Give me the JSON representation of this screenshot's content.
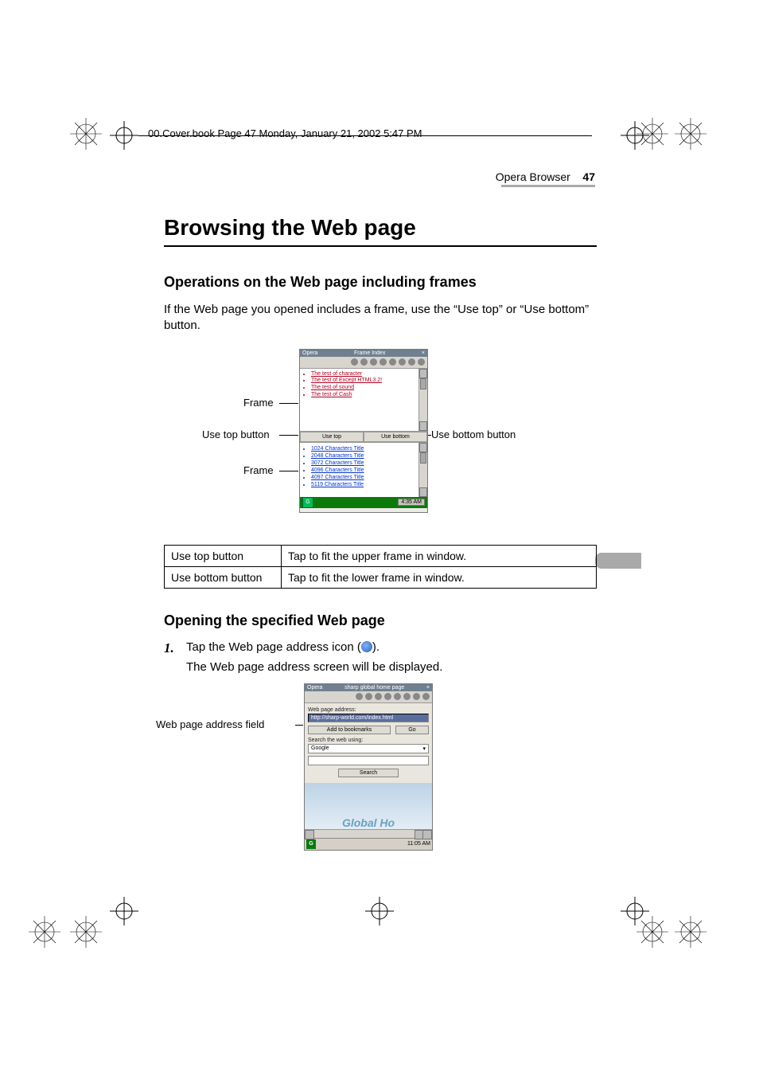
{
  "header_text": "00.Cover.book  Page 47  Monday, January 21, 2002  5:47 PM",
  "running_head": {
    "section": "Opera Browser",
    "page": "47"
  },
  "title": "Browsing the Web page",
  "sub1": "Operations on the Web page including frames",
  "para1": "If the Web page you opened includes a frame, use the “Use top” or “Use bottom” button.",
  "fig1": {
    "frame_label": "Frame",
    "use_top_label": "Use top button",
    "use_bottom_label": "Use bottom button",
    "shot": {
      "titlebar_left": "Opera",
      "titlebar_right": "Frame Index",
      "frame_links": [
        "The test of character",
        "The test of Except HTML3.2!",
        "The test of sound",
        "The test of Cash"
      ],
      "use_top": "Use top",
      "use_bottom": "Use bottom",
      "lower_links": [
        "1024 Characters Title",
        "2048 Characters Title",
        "3072 Characters Title",
        "4096 Characters Title",
        "4097 Characters Title",
        "5119 Characters Title"
      ],
      "taskbar_time": "4:35 AM"
    }
  },
  "table": {
    "r1c1": "Use top button",
    "r1c2": "Tap to fit the upper frame in window.",
    "r2c1": "Use bottom button",
    "r2c2": "Tap to fit the lower frame in window."
  },
  "sub2": "Opening the specified Web page",
  "step1": {
    "num": "1.",
    "text_before": "Tap the Web page address icon (",
    "text_after": ").",
    "result": "The Web page address screen will be displayed."
  },
  "fig2": {
    "label": "Web page address field",
    "shot": {
      "titlebar_left": "Opera",
      "titlebar_right": "sharp global home page",
      "label_addr": "Web page address:",
      "addr_value": "http://sharp-world.com/index.html",
      "btn_add": "Add to bookmarks",
      "btn_go": "Go",
      "label_search": "Search the web using:",
      "engine": "Google",
      "btn_search": "Search",
      "cloud_text": "Global Ho",
      "taskbar_time": "11:05 AM"
    }
  }
}
